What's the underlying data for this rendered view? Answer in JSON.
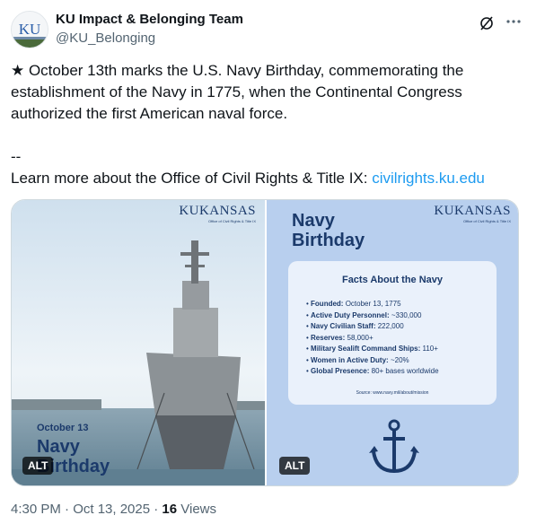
{
  "author": {
    "name": "KU Impact & Belonging Team",
    "handle": "@KU_Belonging",
    "avatar_text": "KU"
  },
  "tweet": {
    "line1": "★ October 13th marks the U.S. Navy Birthday, commemorating the establishment of the Navy in 1775, when the Continental Congress authorized the first American naval force.",
    "separator": "--",
    "learn_more": "Learn more about the Office of Civil Rights & Title IX: ",
    "link_text": "civilrights.ku.edu"
  },
  "media_left": {
    "brand": "KUKANSAS",
    "brand_sub": "Office of Civil Rights & Title IX",
    "date_text": "October 13",
    "title_line1": "Navy",
    "title_line2": "Birthday",
    "alt": "ALT"
  },
  "media_right": {
    "brand": "KUKANSAS",
    "brand_sub": "Office of Civil Rights & Title IX",
    "title_line1": "Navy",
    "title_line2": "Birthday",
    "facts_title": "Facts About the Navy",
    "facts": [
      {
        "label": "Founded:",
        "value": "October 13, 1775"
      },
      {
        "label": "Active Duty Personnel:",
        "value": "~330,000"
      },
      {
        "label": "Navy Civilian Staff:",
        "value": "222,000"
      },
      {
        "label": "Reserves:",
        "value": "58,000+"
      },
      {
        "label": "Military Sealift Command Ships:",
        "value": "110+"
      },
      {
        "label": "Women in Active Duty:",
        "value": "~20%"
      },
      {
        "label": "Global Presence:",
        "value": "80+ bases worldwide"
      }
    ],
    "source": "Source: www.navy.mil/about/mission",
    "alt": "ALT"
  },
  "meta": {
    "time": "4:30 PM · Oct 13, 2025 · ",
    "views_count": "16",
    "views_label": " Views"
  },
  "colors": {
    "link": "#1d9bf0",
    "navy": "#1b3a6b",
    "panel_bg": "#b8cfee"
  }
}
